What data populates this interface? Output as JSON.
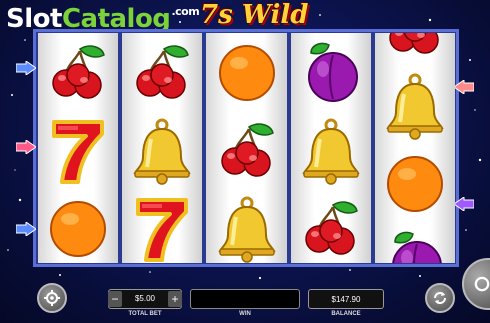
{
  "watermark": {
    "part1": "Slot",
    "part2": "Catalog",
    "suffix": ".com"
  },
  "game_title": "7s Wild",
  "reels": [
    [
      "cherry",
      "seven",
      "orange"
    ],
    [
      "cherry",
      "bell",
      "seven"
    ],
    [
      "orange",
      "cherry",
      "bell"
    ],
    [
      "plum",
      "bell",
      "cherry"
    ],
    [
      "cherry",
      "bell",
      "orange",
      "plum"
    ]
  ],
  "colors": {
    "accent_green": "#7bd33a",
    "title_gold": "#ffd23a",
    "frame": "#5a6fd6"
  },
  "controls": {
    "settings_icon": "gear-icon",
    "minus_label": "−",
    "plus_label": "+",
    "total_bet_value": "$5.00",
    "total_bet_label": "TOTAL BET",
    "win_value": "",
    "win_label": "WIN",
    "balance_value": "$147.90",
    "balance_label": "BALANCE",
    "autoplay_icon": "autoplay-icon",
    "spin_icon": "spin-icon"
  }
}
